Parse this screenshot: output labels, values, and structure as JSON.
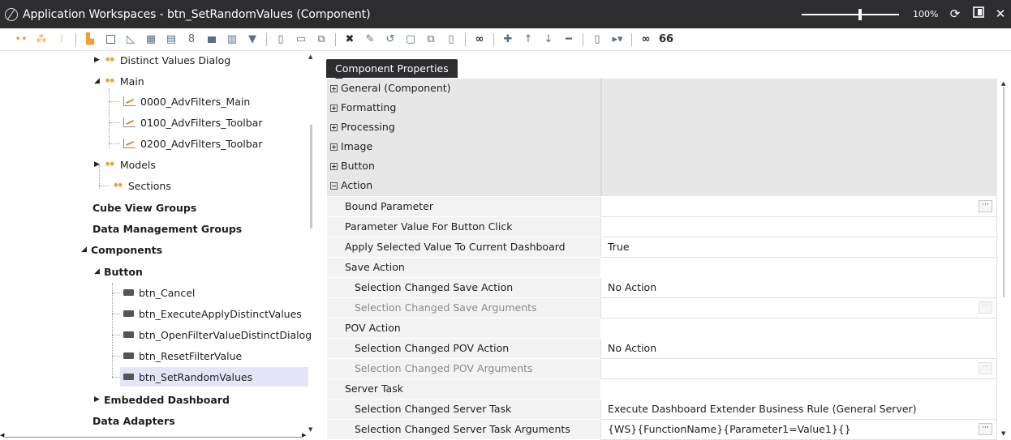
{
  "window": {
    "title": "Application Workspaces - btn_SetRandomValues (Component)",
    "zoom": "100%",
    "buttons": [
      "refresh-icon",
      "dock-icon",
      "close-icon"
    ]
  },
  "toolbar": {
    "icons": [
      "dots-icon",
      "org-icon",
      "add-icon",
      "sep",
      "folder-icon",
      "dashboard-icon",
      "chart-icon",
      "grid-icon",
      "layout-icon",
      "cube-icon",
      "table-icon",
      "book-icon",
      "filter-icon",
      "sep",
      "page-icon",
      "doc-icon",
      "copy-icon",
      "sep",
      "delete-icon",
      "edit-icon",
      "undo-icon",
      "save-icon",
      "copy-window-icon",
      "clipboard-icon",
      "sep",
      "binoculars-icon",
      "sep",
      "plus-icon",
      "up-arrow-icon",
      "down-arrow-icon",
      "minus-icon",
      "sep",
      "export-icon",
      "run-icon",
      "sep",
      "find-icon",
      "glasses-icon"
    ]
  },
  "tree": {
    "items": [
      {
        "label": "Distinct Values Dialog",
        "kind": "dots",
        "arrow": "collapsed"
      },
      {
        "label": "Main",
        "kind": "dots",
        "arrow": "expanded"
      },
      {
        "label": "0000_AdvFilters_Main",
        "kind": "chart"
      },
      {
        "label": "0100_AdvFilters_Toolbar",
        "kind": "chart"
      },
      {
        "label": "0200_AdvFilters_Toolbar",
        "kind": "chart"
      },
      {
        "label": "Models",
        "kind": "dots",
        "arrow": "collapsed"
      },
      {
        "label": "Sections",
        "kind": "dots"
      },
      {
        "label": "Cube View Groups",
        "kind": "group"
      },
      {
        "label": "Data Management Groups",
        "kind": "group"
      },
      {
        "label": "Components",
        "kind": "group",
        "arrow": "expanded"
      },
      {
        "label": "Button",
        "kind": "group",
        "arrow": "expanded"
      },
      {
        "label": "btn_Cancel",
        "kind": "button"
      },
      {
        "label": "btn_ExecuteApplyDistinctValues",
        "kind": "button"
      },
      {
        "label": "btn_OpenFilterValueDistinctDialog",
        "kind": "button"
      },
      {
        "label": "btn_ResetFilterValue",
        "kind": "button"
      },
      {
        "label": "btn_SetRandomValues",
        "kind": "button",
        "selected": true
      },
      {
        "label": "Embedded Dashboard",
        "kind": "group",
        "arrow": "collapsed"
      },
      {
        "label": "Data Adapters",
        "kind": "group"
      }
    ]
  },
  "panel": {
    "tab": "Component Properties",
    "rows": [
      {
        "name": "General (Component)",
        "type": "category",
        "expanded": false
      },
      {
        "name": "Formatting",
        "type": "category",
        "expanded": false
      },
      {
        "name": "Processing",
        "type": "category",
        "expanded": false
      },
      {
        "name": "Image",
        "type": "category",
        "expanded": false
      },
      {
        "name": "Button",
        "type": "category",
        "expanded": false
      },
      {
        "name": "Action",
        "type": "category",
        "expanded": true
      },
      {
        "name": "Bound Parameter",
        "value": "",
        "type": "prop",
        "ellipsis": true
      },
      {
        "name": "Parameter Value For Button Click",
        "value": "",
        "type": "prop"
      },
      {
        "name": "Apply Selected Value To Current Dashboard",
        "value": "True",
        "type": "prop"
      },
      {
        "name": "Save Action",
        "type": "sub"
      },
      {
        "name": "Selection Changed Save Action",
        "value": "No Action",
        "type": "prop2"
      },
      {
        "name": "Selection Changed Save Arguments",
        "value": "",
        "type": "prop2",
        "disabled": true,
        "ellipsis": true
      },
      {
        "name": "POV Action",
        "type": "sub"
      },
      {
        "name": "Selection Changed POV Action",
        "value": "No Action",
        "type": "prop2"
      },
      {
        "name": "Selection Changed POV Arguments",
        "value": "",
        "type": "prop2",
        "disabled": true,
        "ellipsis": true
      },
      {
        "name": "Server Task",
        "type": "sub"
      },
      {
        "name": "Selection Changed Server Task",
        "value": "Execute Dashboard Extender Business Rule (General Server)",
        "type": "prop2"
      },
      {
        "name": "Selection Changed Server Task Arguments",
        "value": "{WS}{FunctionName}{Parameter1=Value1}{}",
        "type": "prop2",
        "ellipsis": true
      }
    ]
  },
  "colors": {
    "titlebar": "#2d2d30",
    "accent_orange": "#f0a030",
    "selection": "#e4e6f7",
    "category_bg": "#e7e7e7"
  }
}
